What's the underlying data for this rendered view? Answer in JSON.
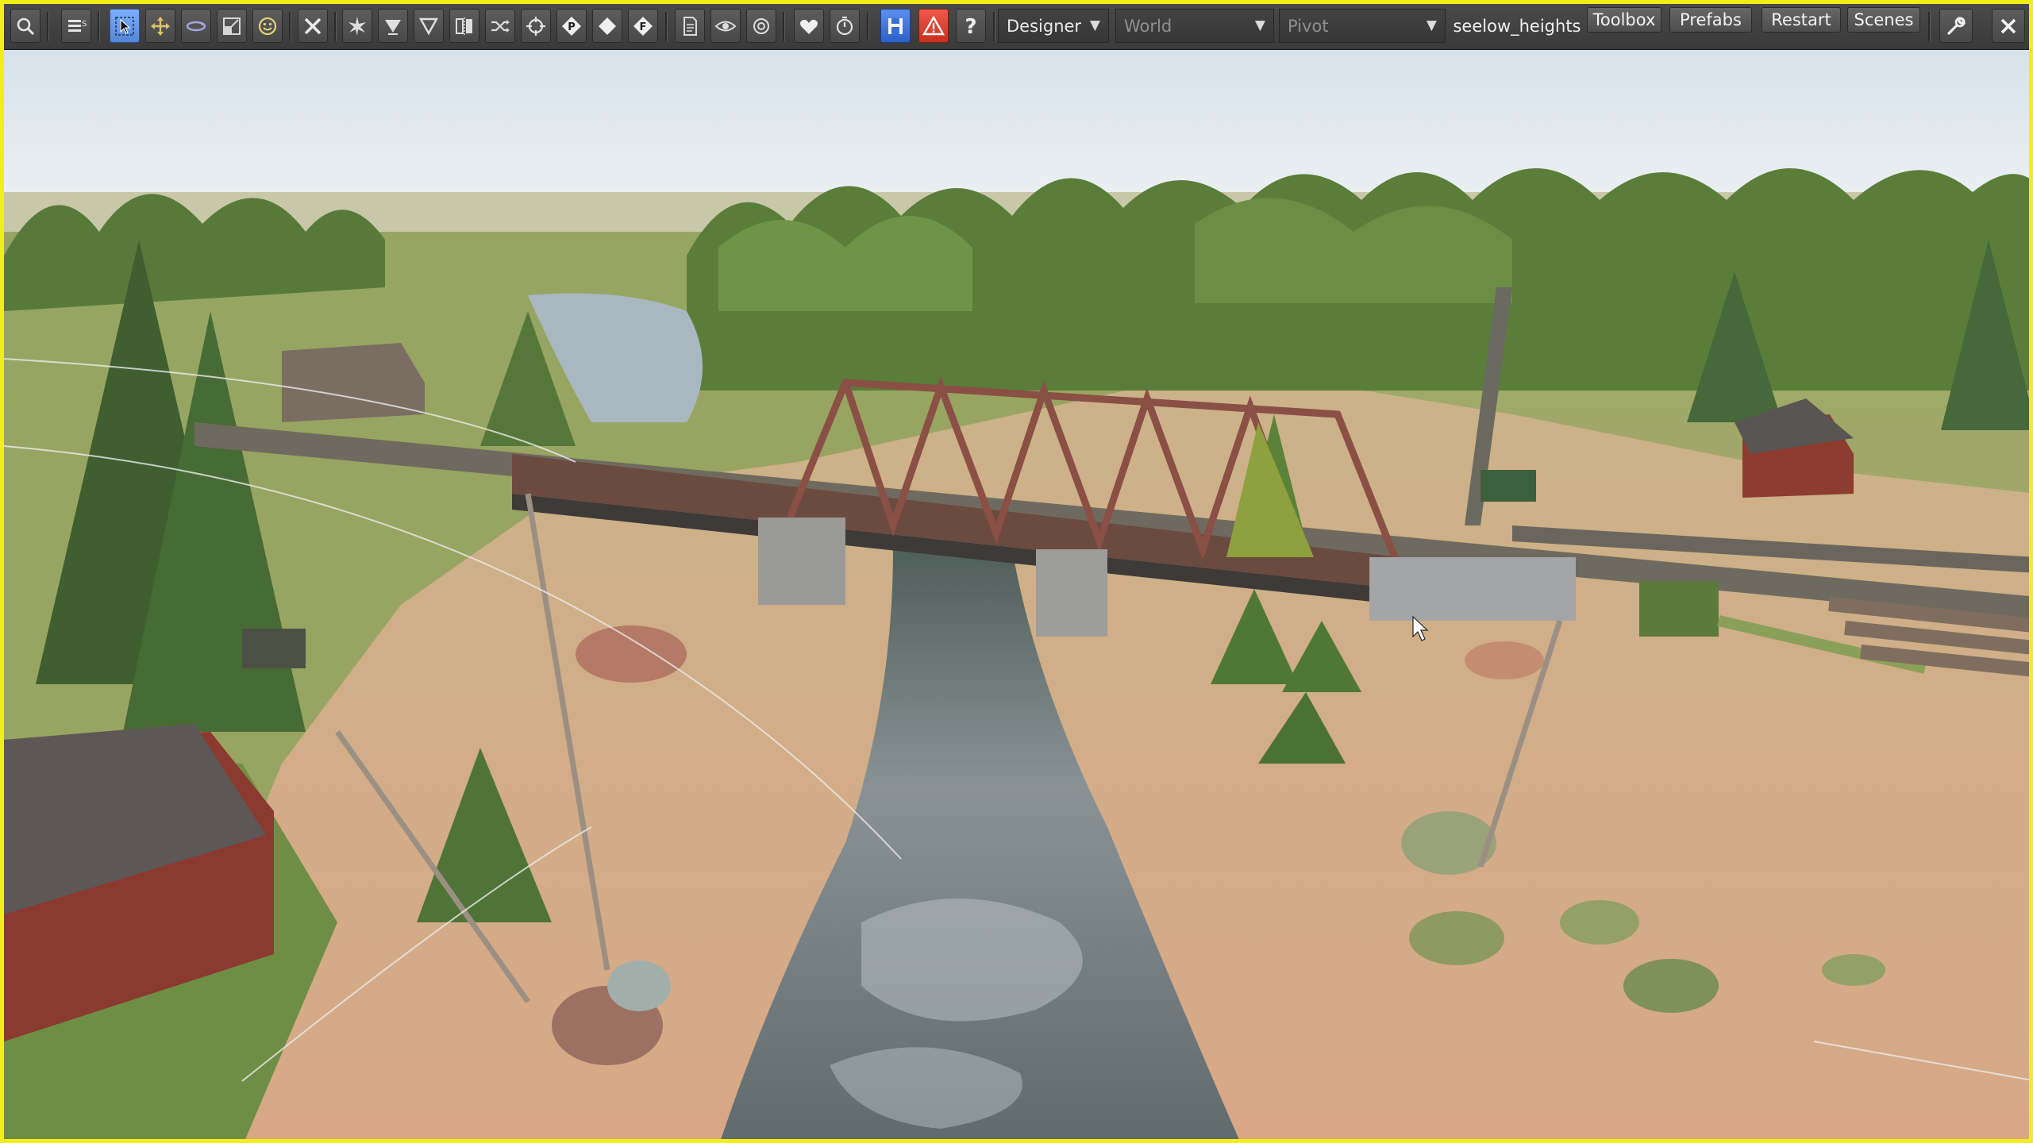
{
  "toolbar": {
    "tools": [
      {
        "name": "search",
        "icon": "search-icon"
      },
      {
        "name": "menu",
        "icon": "menu-icon"
      },
      {
        "name": "select",
        "icon": "select-arrow-icon"
      },
      {
        "name": "move",
        "icon": "move-icon"
      },
      {
        "name": "rotate",
        "icon": "rotate-icon"
      },
      {
        "name": "scale",
        "icon": "scale-icon"
      },
      {
        "name": "smiley",
        "icon": "smiley-icon"
      },
      {
        "name": "delete",
        "icon": "close-x-icon"
      },
      {
        "name": "snap",
        "icon": "snap-star-icon"
      },
      {
        "name": "ground",
        "icon": "funnel-down-icon"
      },
      {
        "name": "drop",
        "icon": "triangle-down-icon"
      },
      {
        "name": "mirror",
        "icon": "mirror-icon"
      },
      {
        "name": "shuffle",
        "icon": "shuffle-icon"
      },
      {
        "name": "crosshair",
        "icon": "crosshair-icon"
      },
      {
        "name": "pivot",
        "icon": "p-badge-icon"
      },
      {
        "name": "diamond",
        "icon": "diamond-icon"
      },
      {
        "name": "focus",
        "icon": "f-badge-icon"
      },
      {
        "name": "document",
        "icon": "document-icon"
      },
      {
        "name": "visibility",
        "icon": "eye-icon"
      },
      {
        "name": "vision",
        "icon": "eye-outline-icon"
      },
      {
        "name": "favorite",
        "icon": "heart-icon"
      },
      {
        "name": "timer",
        "icon": "stopwatch-icon"
      },
      {
        "name": "save",
        "icon": "save-disk-icon"
      },
      {
        "name": "warnings",
        "icon": "warning-icon"
      },
      {
        "name": "help",
        "icon": "help-icon"
      }
    ],
    "mode_dropdown": {
      "value": "Designer",
      "arrow": "▼"
    },
    "space_dropdown": {
      "value": "World",
      "arrow": "▼"
    },
    "pivot_dropdown": {
      "value": "Pivot",
      "arrow": "▼"
    },
    "scene_name": "seelow_heights",
    "buttons": {
      "toolbox": "Toolbox",
      "prefabs": "Prefabs",
      "restart": "Restart",
      "scenes": "Scenes"
    },
    "settings_icon": "wrench-icon",
    "close_icon": "close-icon"
  },
  "colors": {
    "frame_border": "#f2ee17",
    "toolbar_bg": "#3f3f3f",
    "active_tool": "#6a9ef0",
    "save_blue": "#3a6fd8",
    "warning_red": "#e0412f",
    "sky": "#e6eef2",
    "sand": "#d9ad8c",
    "grass": "#7f9a4e",
    "trees": "#5a7e3a",
    "water": "#7d868a",
    "bridge": "#8a4f45"
  }
}
